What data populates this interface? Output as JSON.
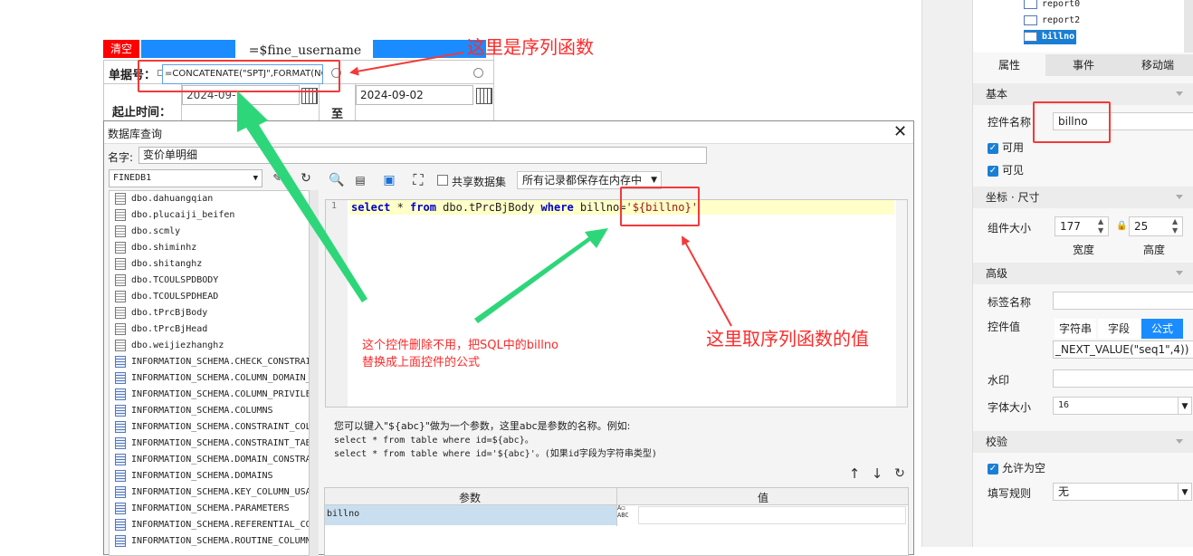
{
  "form": {
    "clear_label": "清空",
    "header_formula": "=$fine_username",
    "bill_no_label": "单据号：",
    "bill_no_formula": "=CONCATENATE(\"SPTJ\",FORMAT(NO",
    "date_start": "2024-09-",
    "date_start_faded": "2024-09-0",
    "date_end": "2024-09-02",
    "date_range_label": "起止时间：",
    "to_label": "至"
  },
  "dialog": {
    "title": "数据库查询",
    "name_label": "名字:",
    "name_value": "变价单明细",
    "datasource": "FINEDB1",
    "share_dataset": "共享数据集",
    "store_mode": "所有记录都保存在内存中",
    "tables": [
      "dbo.dahuangqian",
      "dbo.plucaiji_beifen",
      "dbo.scmly",
      "dbo.shiminhz",
      "dbo.shitanghz",
      "dbo.TCOULSPDBODY",
      "dbo.TCOULSPDHEAD",
      "dbo.tPrcBjBody",
      "dbo.tPrcBjHead",
      "dbo.weijiezhanghz"
    ],
    "views": [
      "INFORMATION_SCHEMA.CHECK_CONSTRAI",
      "INFORMATION_SCHEMA.COLUMN_DOMAIN_",
      "INFORMATION_SCHEMA.COLUMN_PRIVILE",
      "INFORMATION_SCHEMA.COLUMNS",
      "INFORMATION_SCHEMA.CONSTRAINT_COL",
      "INFORMATION_SCHEMA.CONSTRAINT_TAB",
      "INFORMATION_SCHEMA.DOMAIN_CONSTRA",
      "INFORMATION_SCHEMA.DOMAINS",
      "INFORMATION_SCHEMA.KEY_COLUMN_USA",
      "INFORMATION_SCHEMA.PARAMETERS",
      "INFORMATION_SCHEMA.REFERENTIAL_CO",
      "INFORMATION_SCHEMA.ROUTINE_COLUMN"
    ],
    "sql": {
      "line_no": "1",
      "kw_select": "select",
      "star": " * ",
      "kw_from": "from",
      "table": " dbo.tPrcBjBody ",
      "kw_where": "where",
      "cond": " billno=",
      "quote_open": "'",
      "param": "${billno}",
      "quote_close": "'"
    },
    "help_line1": "您可以键入\"${abc}\"做为一个参数，这里abc是参数的名称。例如:",
    "help_line2": "select * from table where id=${abc}。",
    "help_line3": "select * from table where id='${abc}'。(如果id字段为字符串类型)",
    "param_col": "参数",
    "value_col": "值",
    "param_name": "billno",
    "param_type_top": "A◻",
    "param_type_bottom": "ABC"
  },
  "annotations": {
    "seq_func": "这里是序列函数",
    "delete_note_1": "这个控件删除不用，把SQL中的billno",
    "delete_note_2": "替换成上面控件的公式",
    "take_value": "这里取序列函数的值"
  },
  "panel": {
    "tree": [
      "report0",
      "report2",
      "billno"
    ],
    "tabs": [
      "属性",
      "事件",
      "移动端"
    ],
    "basic": "基本",
    "widget_name_label": "控件名称",
    "widget_name_value": "billno",
    "enabled": "可用",
    "visible": "可见",
    "coord_size": "坐标 · 尺寸",
    "component_size": "组件大小",
    "width_value": "177",
    "height_value": "25",
    "width_label": "宽度",
    "height_label": "高度",
    "advanced": "高级",
    "tag_name": "标签名称",
    "widget_value": "控件值",
    "value_tabs": [
      "字符串",
      "字段",
      "公式"
    ],
    "formula_value": "_NEXT_VALUE(\"seq1\",4))",
    "watermark": "水印",
    "font_size_label": "字体大小",
    "font_size_value": "16",
    "validate": "校验",
    "allow_empty": "允许为空",
    "fill_rule": "填写规则",
    "fill_rule_value": "无"
  },
  "colors": {
    "annotation_red": "#ff2a2a",
    "arrow_green": "#2ed67a",
    "accent_blue": "#1a8cff",
    "sql_highlight": "#ffffc8"
  }
}
